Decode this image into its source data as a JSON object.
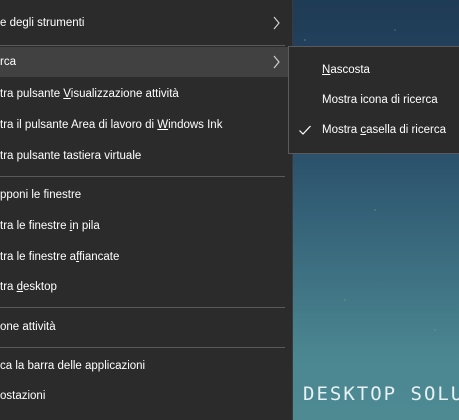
{
  "wallpaper": {
    "brand_text": "DESKTOP SOLU"
  },
  "context_menu": {
    "items": [
      {
        "pre": "e degli strumenti",
        "u": "",
        "post": "",
        "has_submenu": true
      },
      {
        "pre": "rca",
        "u": "",
        "post": "",
        "has_submenu": true,
        "active": true
      },
      {
        "pre": "tra pulsante ",
        "u": "V",
        "post": "isualizzazione attività"
      },
      {
        "pre": "tra il pulsante Area di lavoro di ",
        "u": "W",
        "post": "indows Ink"
      },
      {
        "pre": "tra pulsante tastiera virtuale",
        "u": "",
        "post": ""
      },
      {
        "pre": "pponi le finestre",
        "u": "",
        "post": ""
      },
      {
        "pre": "tra le finestre ",
        "u": "i",
        "post": "n pila"
      },
      {
        "pre": "tra le finestre a",
        "u": "f",
        "post": "fiancate"
      },
      {
        "pre": "tra ",
        "u": "d",
        "post": "esktop"
      },
      {
        "pre": "one attività",
        "u": "",
        "post": ""
      },
      {
        "pre": "ca la barra delle applicazioni",
        "u": "",
        "post": ""
      },
      {
        "pre": "ostazioni",
        "u": "",
        "post": ""
      }
    ]
  },
  "search_submenu": {
    "items": [
      {
        "u": "N",
        "post": "ascosta",
        "checked": false
      },
      {
        "pre": "Mostra icona di ricerca",
        "checked": false
      },
      {
        "pre": "Mostra ",
        "u": "c",
        "post": "asella di ricerca",
        "checked": true
      }
    ]
  },
  "colors": {
    "menu_bg": "#2b2b2b",
    "menu_active_bg": "#414141",
    "separator": "#5a5a5a",
    "text": "#ffffff"
  },
  "icons": {
    "chevron": "chevron-right-icon",
    "check": "checkmark-icon"
  }
}
